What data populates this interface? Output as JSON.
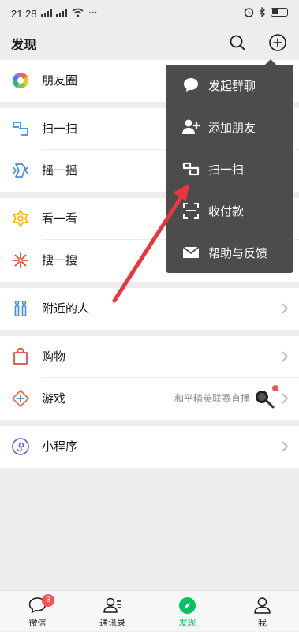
{
  "status": {
    "time": "21:28",
    "more": "···"
  },
  "header": {
    "title": "发现"
  },
  "rows": {
    "moments": "朋友圈",
    "scan": "扫一扫",
    "shake": "摇一摇",
    "top_stories": "看一看",
    "search": "搜一搜",
    "nearby": "附近的人",
    "shopping": "购物",
    "games": "游戏",
    "games_extra": "和平精英联赛直播",
    "mini_programs": "小程序"
  },
  "menu": {
    "items": [
      "发起群聊",
      "添加朋友",
      "扫一扫",
      "收付款",
      "帮助与反馈"
    ]
  },
  "tabs": [
    {
      "label": "微信",
      "badge": "3"
    },
    {
      "label": "通讯录"
    },
    {
      "label": "发现"
    },
    {
      "label": "我"
    }
  ],
  "colors": {
    "accent": "#07c160",
    "badge": "#fa5151",
    "arrow": "#e8363a",
    "menu_bg": "#4c4c4c"
  }
}
